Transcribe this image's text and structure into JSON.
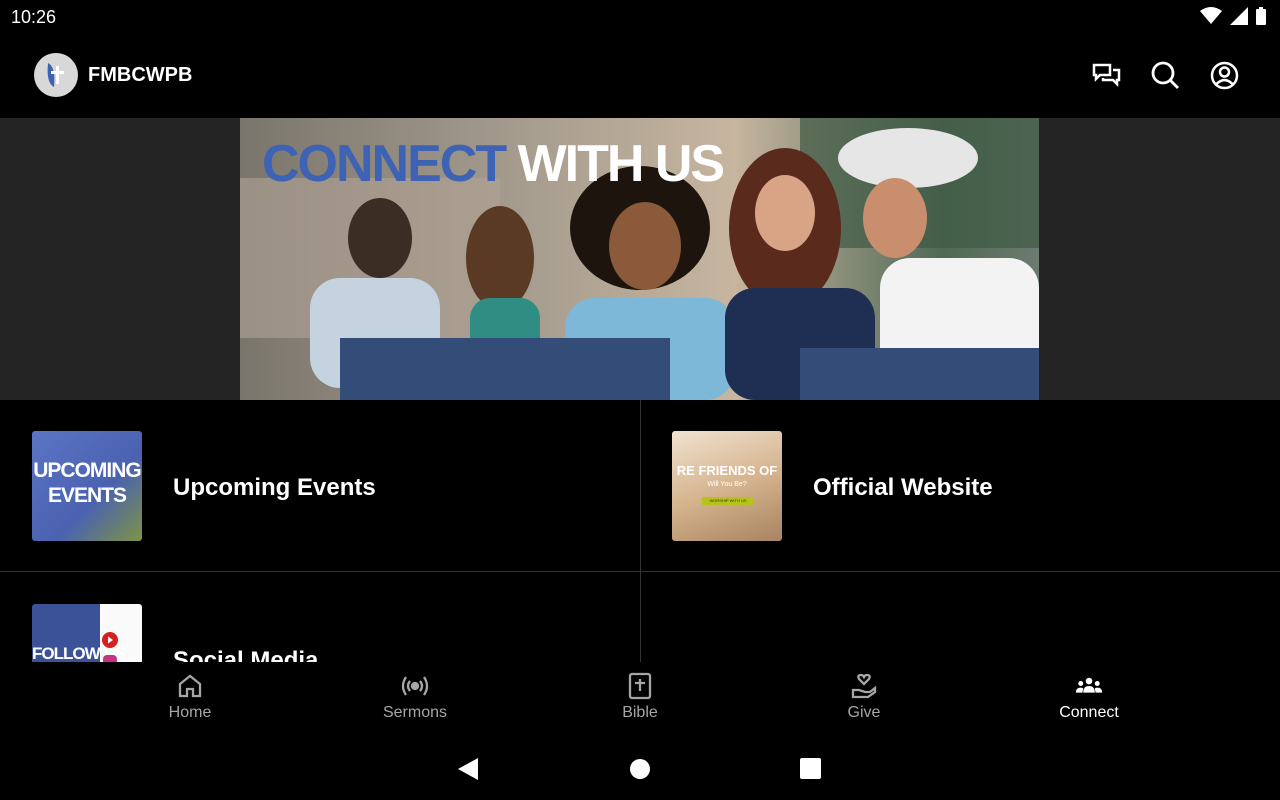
{
  "status": {
    "time": "10:26"
  },
  "app": {
    "name": "FMBCWPB"
  },
  "banner": {
    "title_part1": "CONNECT",
    "title_part2": "WITH US"
  },
  "cards": [
    {
      "label": "Upcoming Events",
      "thumb_text_line1": "UPCOMING",
      "thumb_text_line2": "EVENTS"
    },
    {
      "label": "Official Website",
      "thumb_text": "RE FRIENDS OF",
      "thumb_sub": "Will You Be?",
      "thumb_button": "WORSHIP WITH US"
    },
    {
      "label": "Social Media",
      "thumb_text": "FOLLOW US"
    }
  ],
  "nav": [
    {
      "label": "Home",
      "icon": "home-icon"
    },
    {
      "label": "Sermons",
      "icon": "broadcast-icon"
    },
    {
      "label": "Bible",
      "icon": "bible-icon"
    },
    {
      "label": "Give",
      "icon": "give-icon"
    },
    {
      "label": "Connect",
      "icon": "people-icon",
      "active": true
    }
  ],
  "colors": {
    "accent_blue": "#3f63b4",
    "background": "#000000",
    "banner_bg": "#242424",
    "inactive_nav": "#a6a6a6"
  }
}
